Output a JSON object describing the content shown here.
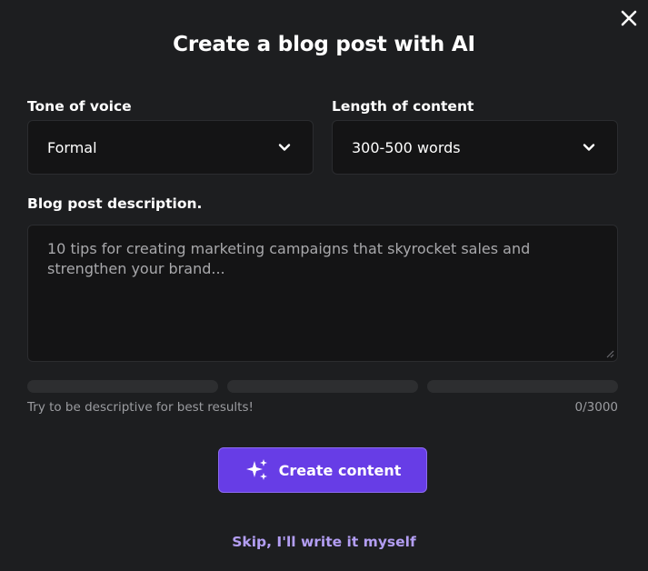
{
  "modal": {
    "title": "Create a blog post with AI",
    "close_icon": "close-icon"
  },
  "tone": {
    "label": "Tone of voice",
    "selected": "Formal",
    "icon": "chevron-down-icon"
  },
  "length": {
    "label": "Length of content",
    "selected": "300-500 words",
    "icon": "chevron-down-icon"
  },
  "description": {
    "label": "Blog post description.",
    "placeholder": "10 tips for creating marketing campaigns that skyrocket sales and strengthen your brand...",
    "value": "",
    "hint": "Try to be descriptive for best results!",
    "counter": "0/3000",
    "strength_segments_filled": 0,
    "strength_segments_total": 3
  },
  "actions": {
    "create_label": "Create content",
    "create_icon": "sparkles-icon",
    "skip_label": "Skip, I'll write it myself"
  },
  "colors": {
    "background": "#1d1e20",
    "field_background": "#141415",
    "accent": "#673de6",
    "link": "#b39ef3",
    "muted_text": "#9b9ca0"
  }
}
